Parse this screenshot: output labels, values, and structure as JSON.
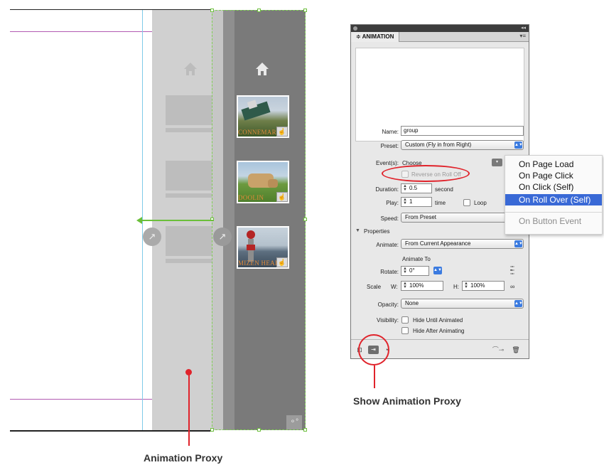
{
  "layout_view": {
    "thumbnails": [
      {
        "label": "CONNEMARA"
      },
      {
        "label": "DOOLIN"
      },
      {
        "label": "MIZEN HEAD"
      }
    ],
    "caption": "Animation Proxy"
  },
  "panel": {
    "tab_label": "≑ ANIMATION",
    "name_label": "Name:",
    "name_value": "group",
    "preset_label": "Preset:",
    "preset_value": "Custom (Fly in from Right)",
    "events_label": "Event(s):",
    "events_value": "Choose",
    "reverse_label": "Reverse on Roll Off",
    "duration_label": "Duration:",
    "duration_value": "0.5",
    "duration_unit": "second",
    "play_label": "Play:",
    "play_value": "1",
    "play_unit": "time",
    "loop_label": "Loop",
    "speed_label": "Speed:",
    "speed_value": "From Preset",
    "properties_label": "Properties",
    "animate_label": "Animate:",
    "animate_value": "From Current Appearance",
    "animate_to_label": "Animate To",
    "rotate_label": "Rotate:",
    "rotate_value": "0°",
    "scale_label": "Scale",
    "scale_w_label": "W:",
    "scale_w_value": "100%",
    "scale_h_label": "H:",
    "scale_h_value": "100%",
    "opacity_label": "Opacity:",
    "opacity_value": "None",
    "visibility_label": "Visibility:",
    "hide_until_label": "Hide Until Animated",
    "hide_after_label": "Hide After Animating"
  },
  "events_menu": {
    "items": [
      "On Page Load",
      "On Page Click",
      "On Click (Self)",
      "On Roll Over (Self)",
      "On Button Event"
    ],
    "highlighted": "On Roll Over (Self)",
    "disabled": "On Button Event"
  },
  "callout": {
    "label": "Show Animation Proxy"
  },
  "colors": {
    "highlight": "#3969d6",
    "callout_red": "#e0232b",
    "guide_purple": "#b25ab2",
    "selection_green": "#6bbf3a"
  }
}
